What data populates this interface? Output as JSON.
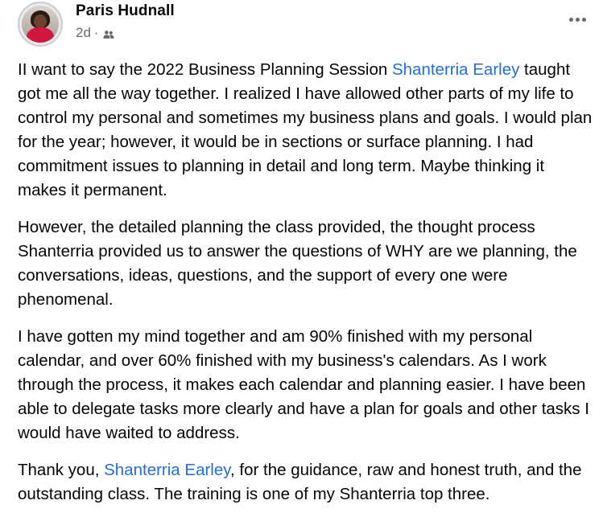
{
  "post": {
    "author": "Paris Hudnall",
    "time": "2d",
    "separator": "·",
    "privacy_icon": "friends-icon",
    "more_icon": "more-options-icon",
    "colors": {
      "mention": "#216fdb",
      "text": "#050505",
      "secondary": "#65676b"
    },
    "paragraphs": {
      "p1": {
        "a": "II  want to say the 2022 Business Planning Session ",
        "mention": "Shanterria Earley",
        "b": " taught got me all the way together. I realized I have allowed other parts of my life to control my personal and sometimes my business plans and goals. I would plan for the year; however, it would be in sections or surface planning. I had commitment issues to planning in detail and long term. Maybe thinking it makes it permanent."
      },
      "p2": "However, the detailed planning the class provided, the thought process Shanterria provided us to answer the questions of WHY are we planning, the conversations, ideas, questions, and the support of every one were phenomenal.",
      "p3": "I have gotten my mind together and am 90% finished with my personal calendar, and over 60% finished with my business's calendars. As I work through the process, it makes each calendar and planning easier. I have been able to delegate tasks more clearly and have a plan for goals and other tasks I would have waited to address.",
      "p4": {
        "a": "Thank you, ",
        "mention": "Shanterria Earley",
        "b": ", for the guidance, raw and honest truth, and the outstanding class. The training is one of my Shanterria top three."
      }
    }
  }
}
